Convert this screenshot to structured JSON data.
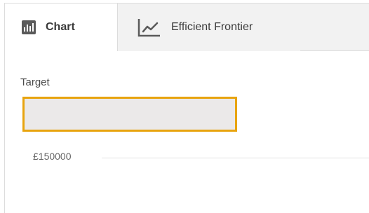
{
  "tabs": [
    {
      "label": "Chart",
      "icon": "bar-chart-icon",
      "active": true
    },
    {
      "label": "Efficient Frontier",
      "icon": "line-chart-icon",
      "active": false
    }
  ],
  "target": {
    "label": "Target",
    "value": "",
    "placeholder": ""
  },
  "chart": {
    "y_tick_label": "£150000"
  },
  "colors": {
    "accent_border": "#e8a40e",
    "input_bg": "#ebe9e9",
    "tab_inactive_bg": "#f2f2f2"
  }
}
